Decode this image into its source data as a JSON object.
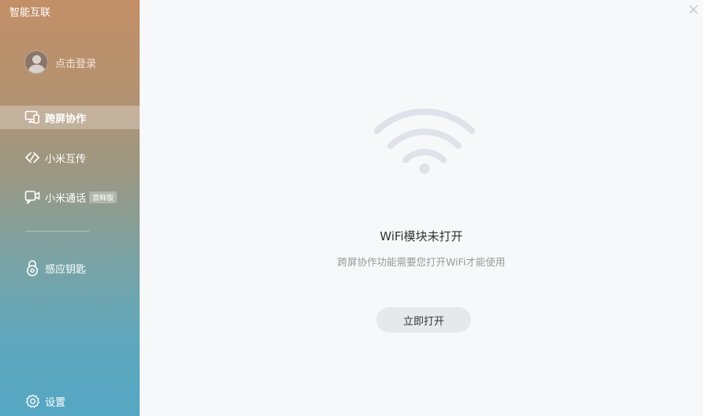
{
  "app": {
    "title": "智能互联"
  },
  "user": {
    "login_label": "点击登录"
  },
  "nav": {
    "items": [
      {
        "label": "跨屏协作",
        "icon": "screen-share-icon",
        "active": true
      },
      {
        "label": "小米互传",
        "icon": "transfer-icon",
        "active": false
      },
      {
        "label": "小米通话",
        "icon": "video-call-icon",
        "active": false,
        "badge": "尝鲜版"
      },
      {
        "label": "感应钥匙",
        "icon": "lock-icon",
        "active": false
      }
    ],
    "settings_label": "设置"
  },
  "main": {
    "status_title": "WiFi模块未打开",
    "status_desc": "跨屏协作功能需要您打开WiFi才能使用",
    "button_label": "立即打开"
  },
  "colors": {
    "sidebar_top": "#c38f68",
    "sidebar_bottom": "#56a7c4",
    "wifi_icon": "#dfe2e8",
    "button_bg": "#e6e8eb",
    "background": "#f7f8fa"
  }
}
